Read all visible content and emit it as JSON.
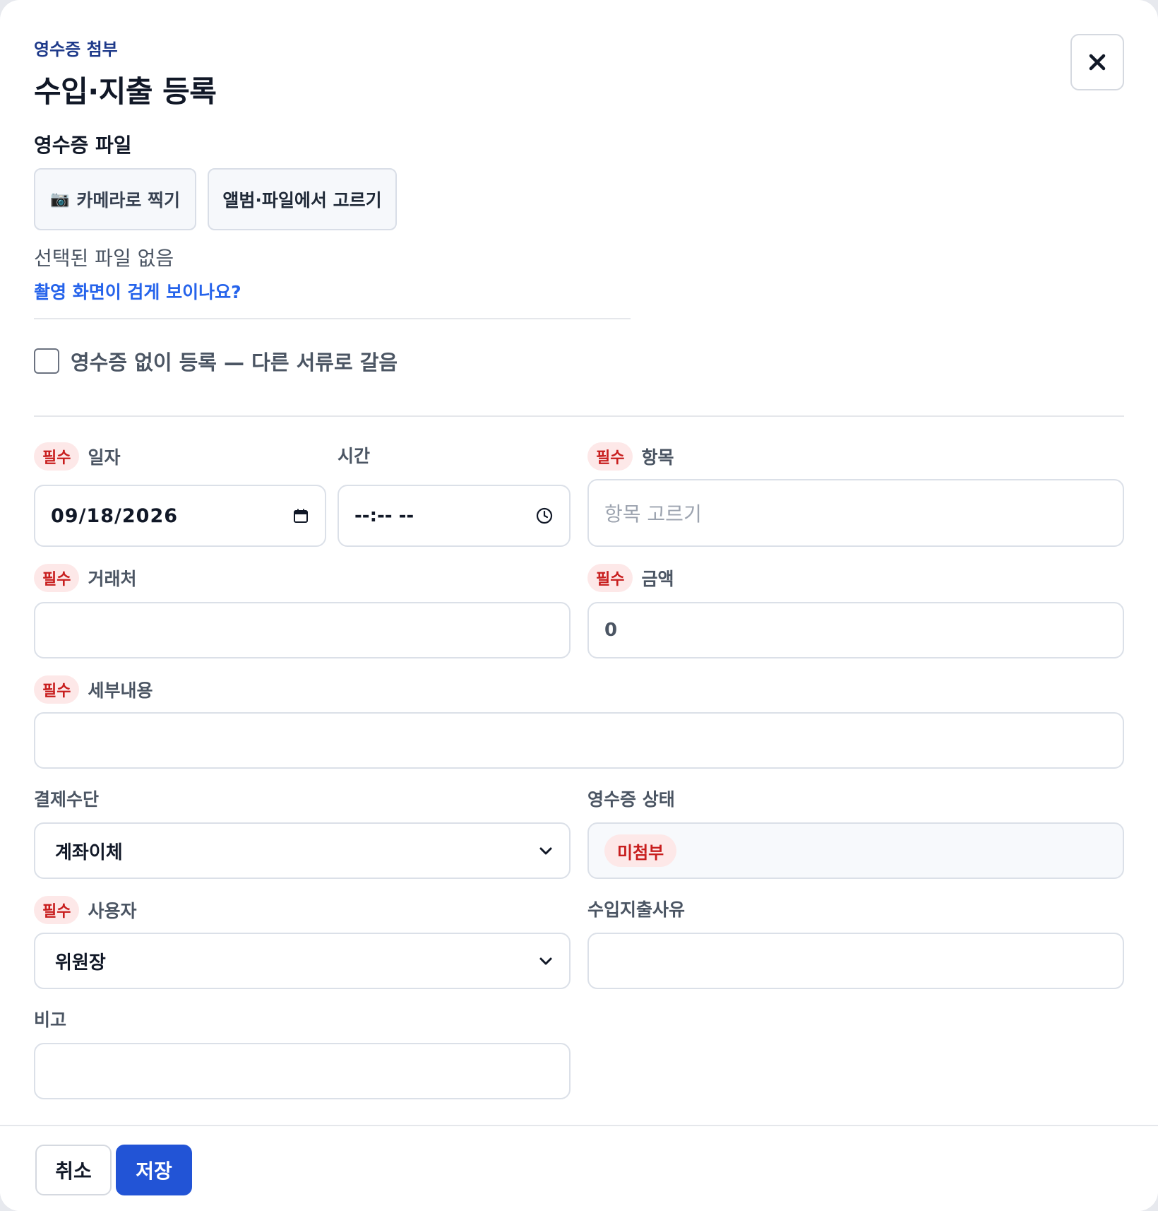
{
  "header": {
    "subtitle": "영수증 첨부",
    "title": "수입·지출 등록",
    "close_icon": "close-icon"
  },
  "receipt": {
    "section_label": "영수증 파일",
    "camera_icon": "📷",
    "camera_button": "카메라로 찍기",
    "album_button": "앨범·파일에서 고르기",
    "no_file_text": "선택된 파일 없음",
    "help_link": "촬영 화면이 검게 보이나요?",
    "no_receipt_checkbox": "영수증 없이 등록 — 다른 서류로 갈음"
  },
  "required_badge": "필수",
  "fields": {
    "date": {
      "label": "일자",
      "value": "09/18/2026"
    },
    "time": {
      "label": "시간",
      "value": "--:-- --"
    },
    "category": {
      "label": "항목",
      "placeholder": "항목 고르기"
    },
    "vendor": {
      "label": "거래처",
      "value": ""
    },
    "amount": {
      "label": "금액",
      "value": "0"
    },
    "details": {
      "label": "세부내용",
      "value": ""
    },
    "payment_method": {
      "label": "결제수단",
      "value": "계좌이체"
    },
    "receipt_status": {
      "label": "영수증 상태",
      "value": "미첨부"
    },
    "user": {
      "label": "사용자",
      "value": "위원장"
    },
    "reason": {
      "label": "수입지출사유",
      "value": ""
    },
    "memo": {
      "label": "비고",
      "value": ""
    }
  },
  "footer": {
    "cancel": "취소",
    "save": "저장"
  },
  "colors": {
    "primary": "#2254d6",
    "link": "#2563eb",
    "required_bg": "#fde8e8",
    "required_text": "#c81e1e",
    "subtitle": "#1e3a8a"
  }
}
